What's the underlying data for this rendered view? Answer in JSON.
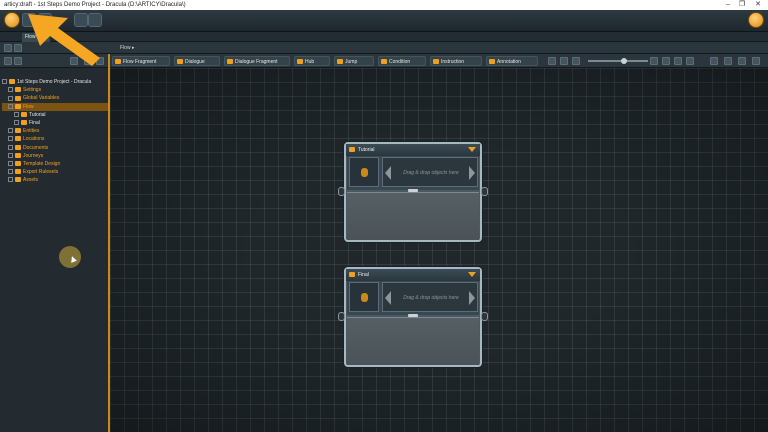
{
  "window": {
    "title": "articy:draft - 1st Steps Demo Project - Dracula (D:\\ARTICY\\Dracula\\)",
    "minimize": "–",
    "maximize": "❐",
    "close": "✕"
  },
  "tabs": [
    {
      "label": "Flow"
    }
  ],
  "breadcrumb": {
    "current": "Flow",
    "separator": "▸"
  },
  "toolbar": {
    "items": [
      {
        "label": "Flow Fragment",
        "icon": "flow-fragment-icon"
      },
      {
        "label": "Dialogue",
        "icon": "dialogue-icon"
      },
      {
        "label": "Dialogue Fragment",
        "icon": "dialogue-fragment-icon"
      },
      {
        "label": "Hub",
        "icon": "hub-icon"
      },
      {
        "label": "Jump",
        "icon": "jump-icon"
      },
      {
        "label": "Condition",
        "icon": "condition-icon"
      },
      {
        "label": "Instruction",
        "icon": "instruction-icon"
      },
      {
        "label": "Annotation",
        "icon": "annotation-icon"
      }
    ],
    "zoom": 0.6
  },
  "tree": {
    "items": [
      {
        "label": "1st Steps Demo Project - Dracula",
        "color": "#e6e6e6",
        "indent": 0
      },
      {
        "label": "Settings",
        "color": "#f0a020",
        "indent": 1
      },
      {
        "label": "Global Variables",
        "color": "#f0a020",
        "indent": 1
      },
      {
        "label": "Flow",
        "color": "#f0a020",
        "indent": 1,
        "selected": true
      },
      {
        "label": "Tutorial",
        "color": "#e6e6e6",
        "indent": 2
      },
      {
        "label": "Final",
        "color": "#e6e6e6",
        "indent": 2
      },
      {
        "label": "Entities",
        "color": "#f0a020",
        "indent": 1
      },
      {
        "label": "Locations",
        "color": "#f0a020",
        "indent": 1
      },
      {
        "label": "Documents",
        "color": "#f0a020",
        "indent": 1
      },
      {
        "label": "Journeys",
        "color": "#f0a020",
        "indent": 1
      },
      {
        "label": "Template Design",
        "color": "#f0a020",
        "indent": 1
      },
      {
        "label": "Export Rulesets",
        "color": "#f0a020",
        "indent": 1
      },
      {
        "label": "Assets",
        "color": "#f0a020",
        "indent": 1
      }
    ]
  },
  "nodes": [
    {
      "title": "Tutorial",
      "drop_text": "Drag & drop objects here"
    },
    {
      "title": "Final",
      "drop_text": "Drag & drop objects here"
    }
  ],
  "colors": {
    "accent": "#f0a020",
    "highlight_arrow": "#f5a623"
  }
}
